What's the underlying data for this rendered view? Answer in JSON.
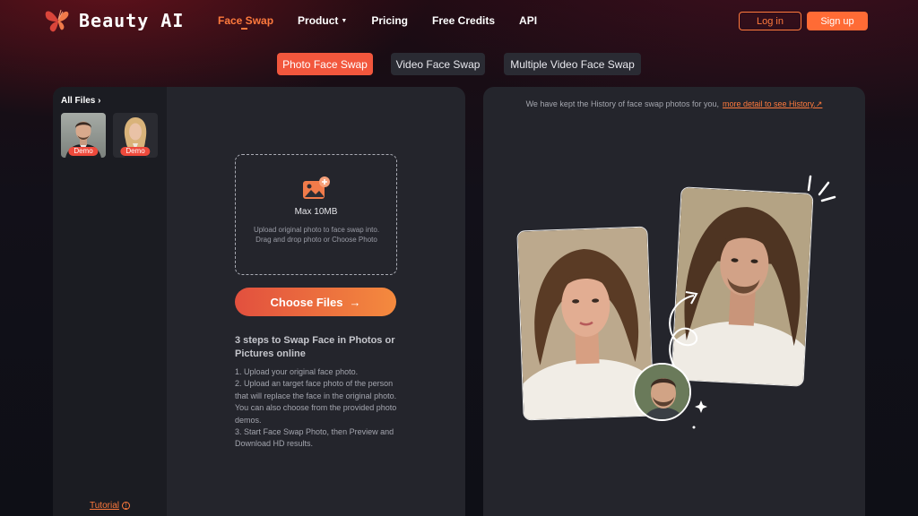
{
  "brand": {
    "name": "Beauty AI"
  },
  "nav": {
    "items": [
      {
        "label": "Face Swap",
        "active": true
      },
      {
        "label": "Product",
        "dropdown": true
      },
      {
        "label": "Pricing"
      },
      {
        "label": "Free Credits"
      },
      {
        "label": "API"
      }
    ],
    "login_label": "Log in",
    "signup_label": "Sign up"
  },
  "mode_tabs": [
    {
      "label": "Photo Face Swap",
      "active": true
    },
    {
      "label": "Video Face Swap"
    },
    {
      "label": "Multiple Video Face Swap"
    }
  ],
  "files": {
    "title": "All Files",
    "demos": [
      {
        "badge": "Demo"
      },
      {
        "badge": "Demo"
      }
    ],
    "tutorial_label": "Tutorial"
  },
  "upload": {
    "max_size": "Max 10MB",
    "hint": "Upload original photo to face swap into. Drag and drop photo or Choose Photo",
    "button_label": "Choose Files",
    "steps_title": "3 steps to Swap Face in Photos or Pictures online",
    "steps": [
      "1. Upload your original face photo.",
      "2. Upload an target face photo of the person that will replace the face in the original photo. You can also choose from the provided photo demos.",
      "3. Start Face Swap Photo, then Preview and Download HD results."
    ]
  },
  "history": {
    "text": "We have kept the History of face swap photos for you,",
    "link": "more detail to see History.↗"
  },
  "colors": {
    "accent": "#ff7a3d",
    "tab_active": "#f2573d",
    "panel": "#24252c"
  }
}
